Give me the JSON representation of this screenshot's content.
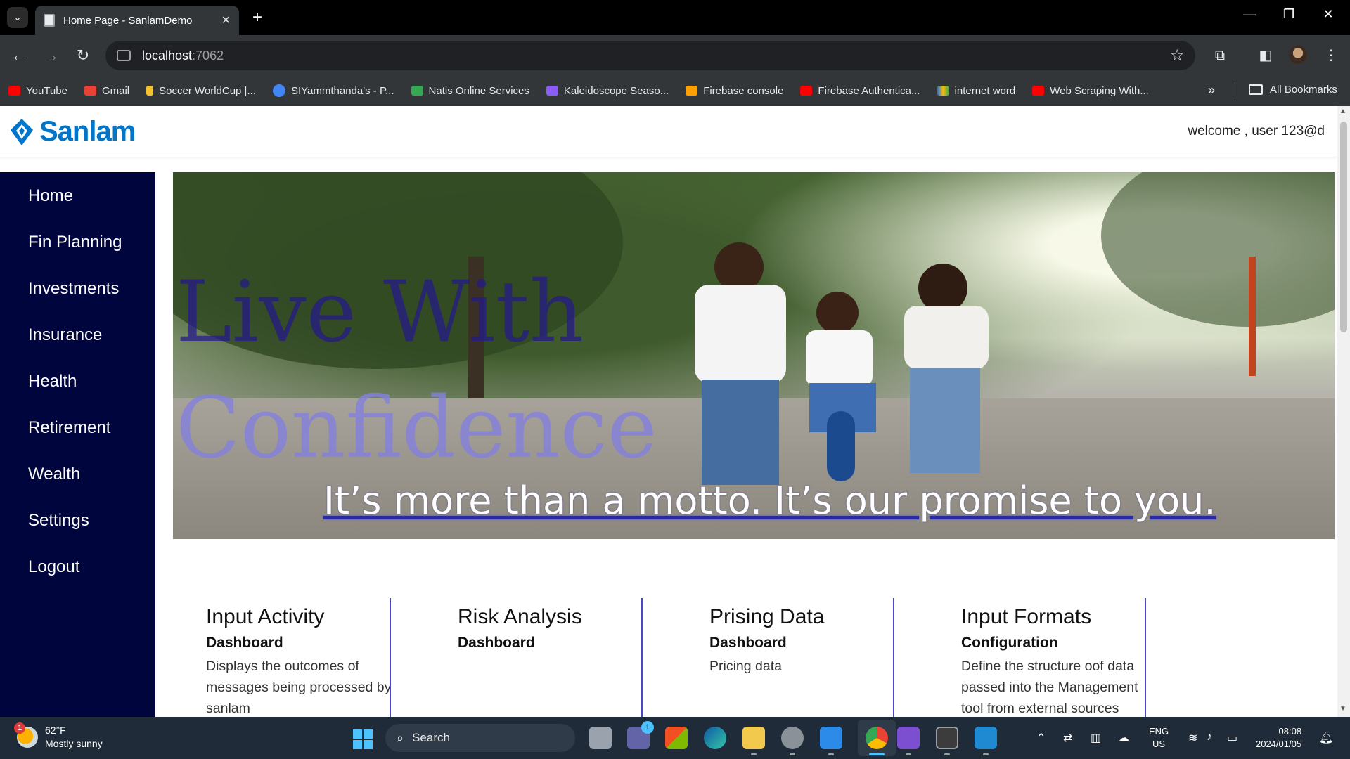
{
  "browser": {
    "tab_title": "Home Page - SanlamDemo",
    "url_host": "localhost",
    "url_port": ":7062",
    "bookmarks": [
      {
        "label": "YouTube",
        "color": "#ff0000"
      },
      {
        "label": "Gmail",
        "color": "#ea4335"
      },
      {
        "label": "Soccer WorldCup |...",
        "color": "#f4c430"
      },
      {
        "label": "SIYammthanda's - P...",
        "color": "#4285f4"
      },
      {
        "label": "Natis Online Services",
        "color": "#34a853"
      },
      {
        "label": "Kaleidoscope Seaso...",
        "color": "#8b5cf6"
      },
      {
        "label": "Firebase console",
        "color": "#ffa000"
      },
      {
        "label": "Firebase Authentica...",
        "color": "#ff0000"
      },
      {
        "label": "internet word",
        "color": "#1a73e8"
      },
      {
        "label": "Web Scraping With...",
        "color": "#ff0000"
      }
    ],
    "all_bookmarks": "All Bookmarks"
  },
  "header": {
    "brand": "Sanlam",
    "brand_color": "#0075c9",
    "welcome": "welcome , user 123@d"
  },
  "sidebar": {
    "bg_color": "#00063d",
    "items": [
      {
        "label": "Home"
      },
      {
        "label": "Fin Planning"
      },
      {
        "label": "Investments"
      },
      {
        "label": "Insurance"
      },
      {
        "label": "Health"
      },
      {
        "label": "Retirement"
      },
      {
        "label": "Wealth"
      },
      {
        "label": "Settings"
      },
      {
        "label": "Logout"
      }
    ]
  },
  "hero": {
    "title_line1": "Live With",
    "title_line2": "Confidence",
    "motto": "It’s more than a motto. It’s our promise to you."
  },
  "cards": [
    {
      "title": "Input Activity",
      "subtitle": "Dashboard",
      "description": "Displays the outcomes of messages being processed by sanlam"
    },
    {
      "title": "Risk Analysis",
      "subtitle": "Dashboard",
      "description": ""
    },
    {
      "title": "Prising Data",
      "subtitle": "Dashboard",
      "description": "Pricing data"
    },
    {
      "title": "Input Formats",
      "subtitle": "Configuration",
      "description": "Define the structure oof data passed into the Management tool from external sources"
    }
  ],
  "taskbar": {
    "weather_temp": "62°F",
    "weather_desc": "Mostly sunny",
    "weather_badge": "1",
    "search_label": "Search",
    "teams_badge": "1",
    "lang_1": "ENG",
    "lang_2": "US",
    "time": "08:08",
    "date": "2024/01/05"
  }
}
